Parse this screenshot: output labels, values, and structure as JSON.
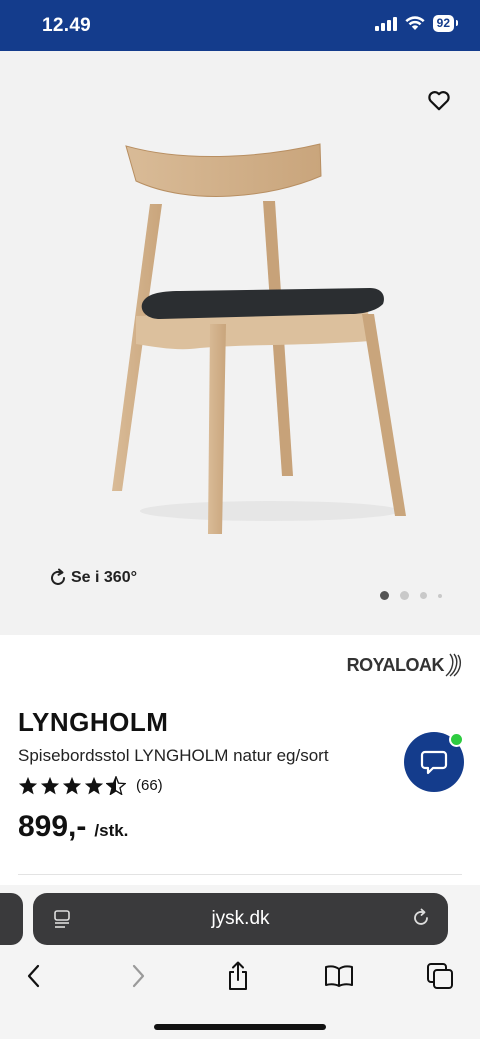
{
  "status_bar": {
    "time": "12.49",
    "battery": "92",
    "background": "#143c8c"
  },
  "hero": {
    "rotate_label": "Se i 360°",
    "page_dots_count": 4,
    "active_dot": 0
  },
  "product": {
    "brand": "ROYALOAK",
    "name": "LYNGHOLM",
    "description": "Spisebordsstol LYNGHOLM natur eg/sort",
    "rating_stars": 4.5,
    "rating_count": "(66)",
    "price": "899,-",
    "price_unit": "/stk."
  },
  "browser": {
    "url": "jysk.dk"
  },
  "icons": [
    "heart-icon",
    "rotate-360-icon",
    "chat-icon",
    "reader-icon",
    "reload-icon",
    "back-icon",
    "forward-icon",
    "share-icon",
    "bookmarks-icon",
    "tabs-icon"
  ]
}
